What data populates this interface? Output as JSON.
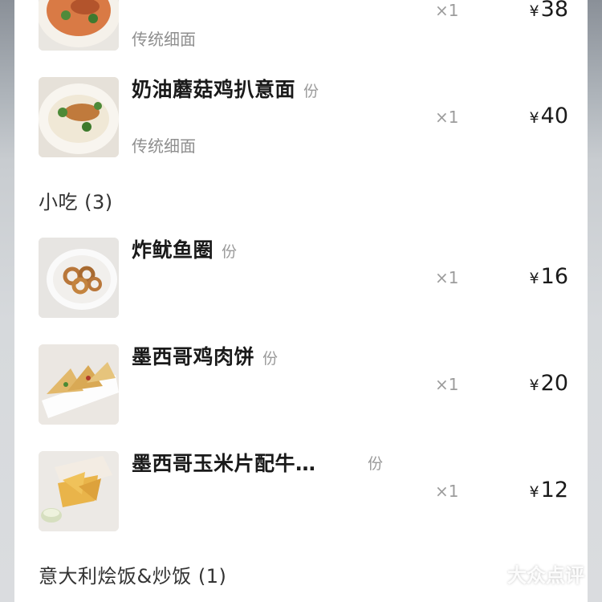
{
  "items": [
    {
      "name": "",
      "unit": "",
      "spec": "传统细面",
      "qty": "×1",
      "price": "38",
      "currency": "¥"
    },
    {
      "name": "奶油蘑菇鸡扒意面",
      "unit": "份",
      "spec": "传统细面",
      "qty": "×1",
      "price": "40",
      "currency": "¥"
    },
    {
      "name": "炸鱿鱼圈",
      "unit": "份",
      "spec": "",
      "qty": "×1",
      "price": "16",
      "currency": "¥"
    },
    {
      "name": "墨西哥鸡肉饼",
      "unit": "份",
      "spec": "",
      "qty": "×1",
      "price": "20",
      "currency": "¥"
    },
    {
      "name": "墨西哥玉米片配牛…",
      "unit": "份",
      "spec": "",
      "qty": "×1",
      "price": "12",
      "currency": "¥"
    }
  ],
  "sections": {
    "snacks": "小吃 (3)",
    "risotto": "意大利烩饭&炒饭 (1)"
  },
  "watermark": {
    "text": "大众点评"
  },
  "icons": {
    "dish_thumbnail": "food-photo-icon",
    "watermark_logo": "dianping-logo-icon"
  }
}
